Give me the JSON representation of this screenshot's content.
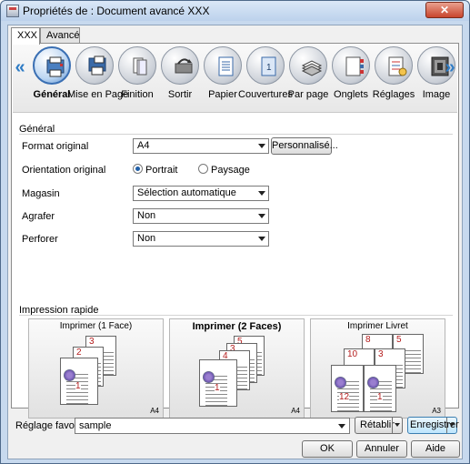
{
  "window": {
    "title": "Propriétés de : Document avancé XXX",
    "close_label": "✕"
  },
  "tabs": [
    "XXX",
    "Avancé"
  ],
  "categories": [
    {
      "label": "Général",
      "icon": "general-icon"
    },
    {
      "label": "Mise en Page",
      "icon": "layout-icon"
    },
    {
      "label": "Finition",
      "icon": "finishing-icon"
    },
    {
      "label": "Sortir",
      "icon": "output-icon"
    },
    {
      "label": "Papier",
      "icon": "paper-icon"
    },
    {
      "label": "Couvertures",
      "icon": "covers-icon"
    },
    {
      "label": "Par page",
      "icon": "per-page-icon"
    },
    {
      "label": "Onglets",
      "icon": "tabs-icon"
    },
    {
      "label": "Réglages",
      "icon": "settings-icon"
    },
    {
      "label": "Image",
      "icon": "image-icon"
    }
  ],
  "general": {
    "group_title": "Général",
    "format_label": "Format original",
    "format_value": "A4",
    "custom_button": "Personnalisé...",
    "orientation_label": "Orientation original",
    "portrait_label": "Portrait",
    "landscape_label": "Paysage",
    "orientation_selected": "Portrait",
    "tray_label": "Magasin",
    "tray_value": "Sélection automatique",
    "staple_label": "Agrafer",
    "staple_value": "Non",
    "punch_label": "Perforer",
    "punch_value": "Non"
  },
  "quick_print": {
    "title": "Impression rapide",
    "cards": [
      {
        "caption": "Imprimer (1 Face)",
        "paper": "A4",
        "bold": false
      },
      {
        "caption": "Imprimer (2 Faces)",
        "paper": "A4",
        "bold": true
      },
      {
        "caption": "Imprimer Livret",
        "paper": "A3",
        "bold": false
      }
    ]
  },
  "footer": {
    "favorite_label": "Réglage favori",
    "favorite_value": "sample",
    "restore_button": "Rétablir",
    "save_button": "Enregistrer",
    "ok_button": "OK",
    "cancel_button": "Annuler",
    "help_button": "Aide"
  }
}
